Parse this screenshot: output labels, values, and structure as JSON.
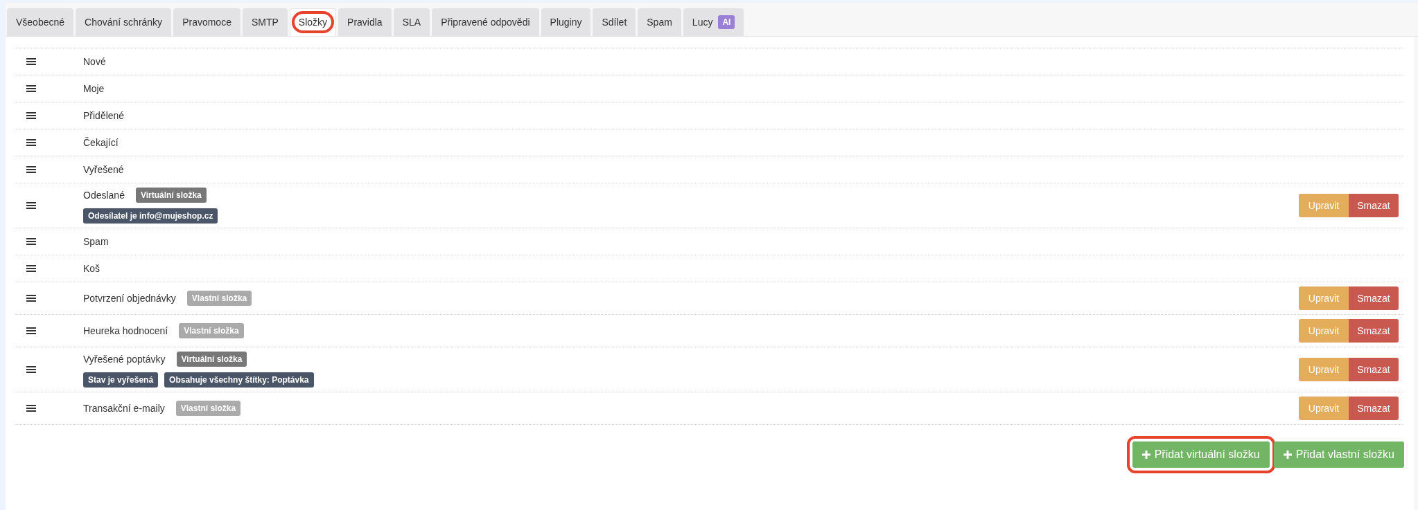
{
  "tabs": [
    {
      "label": "Všeobecné",
      "selected": false,
      "highlighted": false
    },
    {
      "label": "Chování schránky",
      "selected": false,
      "highlighted": false
    },
    {
      "label": "Pravomoce",
      "selected": false,
      "highlighted": false
    },
    {
      "label": "SMTP",
      "selected": false,
      "highlighted": false
    },
    {
      "label": "Složky",
      "selected": true,
      "highlighted": true
    },
    {
      "label": "Pravidla",
      "selected": false,
      "highlighted": false
    },
    {
      "label": "SLA",
      "selected": false,
      "highlighted": false
    },
    {
      "label": "Připravené odpovědi",
      "selected": false,
      "highlighted": false
    },
    {
      "label": "Pluginy",
      "selected": false,
      "highlighted": false
    },
    {
      "label": "Sdílet",
      "selected": false,
      "highlighted": false
    },
    {
      "label": "Spam",
      "selected": false,
      "highlighted": false
    },
    {
      "label": "Lucy",
      "selected": false,
      "highlighted": false,
      "badge": "AI"
    }
  ],
  "folders": [
    {
      "name": "Nové"
    },
    {
      "name": "Moje"
    },
    {
      "name": "Přidělené"
    },
    {
      "name": "Čekající"
    },
    {
      "name": "Vyřešené"
    },
    {
      "name": "Odeslané",
      "type_badge": {
        "text": "Virtuální složka",
        "kind": "virtual"
      },
      "conditions": [
        "Odesílatel je info@mujeshop.cz"
      ],
      "actions": {
        "edit": "Upravit",
        "delete": "Smazat"
      }
    },
    {
      "name": "Spam"
    },
    {
      "name": "Koš"
    },
    {
      "name": "Potvrzení objednávky",
      "type_badge": {
        "text": "Vlastní složka",
        "kind": "custom"
      },
      "actions": {
        "edit": "Upravit",
        "delete": "Smazat"
      }
    },
    {
      "name": "Heureka hodnocení",
      "type_badge": {
        "text": "Vlastní složka",
        "kind": "custom"
      },
      "actions": {
        "edit": "Upravit",
        "delete": "Smazat"
      }
    },
    {
      "name": "Vyřešené poptávky",
      "type_badge": {
        "text": "Virtuální složka",
        "kind": "virtual"
      },
      "conditions": [
        "Stav je vyřešená",
        "Obsahuje všechny štítky: Poptávka"
      ],
      "actions": {
        "edit": "Upravit",
        "delete": "Smazat"
      }
    },
    {
      "name": "Transakční e-maily",
      "type_badge": {
        "text": "Vlastní složka",
        "kind": "custom"
      },
      "actions": {
        "edit": "Upravit",
        "delete": "Smazat"
      }
    }
  ],
  "buttons": [
    {
      "label": "Přidat virtuální složku",
      "highlighted": true
    },
    {
      "label": "Přidat vlastní složku",
      "highlighted": false
    }
  ]
}
